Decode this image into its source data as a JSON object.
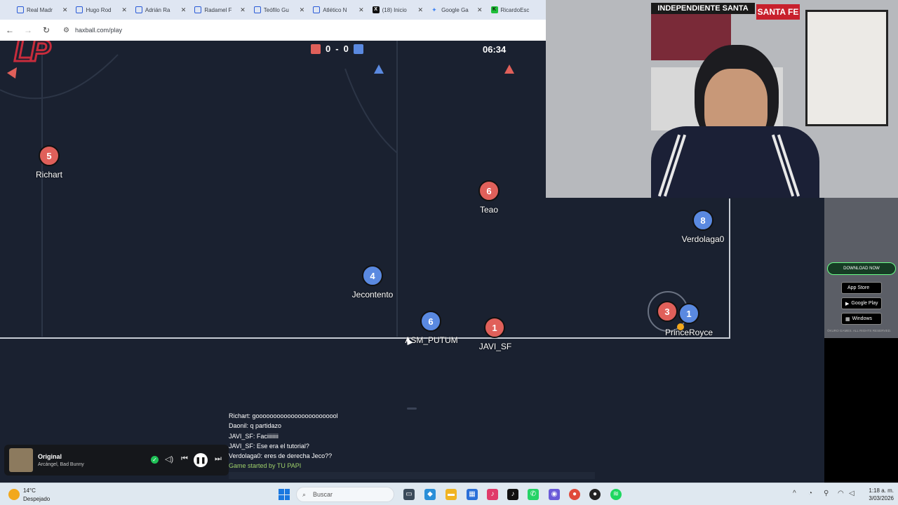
{
  "browser": {
    "tabs": [
      {
        "label": "Real Madr",
        "icon": "page-icon"
      },
      {
        "label": "Hugo Rod",
        "icon": "page-icon"
      },
      {
        "label": "Adrián Ra",
        "icon": "page-icon"
      },
      {
        "label": "Radamel F",
        "icon": "page-icon"
      },
      {
        "label": "Teófilo Gu",
        "icon": "page-icon"
      },
      {
        "label": "Atlético N",
        "icon": "page-icon"
      },
      {
        "label": "(18) Inicio",
        "icon": "x-icon"
      },
      {
        "label": "Google Ga",
        "icon": "gemini-icon"
      },
      {
        "label": "RicardoEsc",
        "icon": "kick-icon"
      }
    ],
    "url": "haxball.com/play"
  },
  "game": {
    "score_red": "0",
    "score_separator": "-",
    "score_blue": "0",
    "timer": "06:34",
    "colors": {
      "red": "#e0605a",
      "blue": "#5a89e0",
      "field": "#1a2130"
    },
    "players": [
      {
        "number": "5",
        "name": "Richart",
        "team": "red"
      },
      {
        "number": "6",
        "name": "Teao",
        "team": "red"
      },
      {
        "number": "8",
        "name": "Verdolaga0",
        "team": "blue"
      },
      {
        "number": "4",
        "name": "Jecontento",
        "team": "blue"
      },
      {
        "number": "6",
        "name": "ASM_PUTUM",
        "team": "blue"
      },
      {
        "number": "1",
        "name": "JAVI_SF",
        "team": "red"
      },
      {
        "number": "3",
        "name": "",
        "team": "red"
      },
      {
        "number": "1",
        "name": "PrinceRoyce",
        "team": "blue"
      }
    ]
  },
  "chat": {
    "messages": [
      "Richart: goooooooooooooooooooooool",
      "Daonil: q partidazo",
      "JAVI_SF: Faciiiiiiii",
      "JAVI_SF: Ese era el tutorial?",
      "Verdolaga0: eres de derecha Jeco??",
      "Game started by TU PAPI"
    ]
  },
  "media": {
    "title": "Original",
    "artist": "Arcángel, Bad Bunny"
  },
  "webcam": {
    "banner": "INDEPENDIENTE SANTA",
    "sign": "SANTA FE"
  },
  "ad": {
    "download": "DOWNLOAD NOW",
    "stores": [
      {
        "small": "Download on the",
        "label": "App Store"
      },
      {
        "small": "GET IT ON",
        "label": "Google Play"
      },
      {
        "small": "Download for",
        "label": "Windows"
      }
    ],
    "copyright": "©KURO GAMES. ALL RIGHTS RESERVED."
  },
  "taskbar": {
    "temperature": "14°C",
    "weather": "Despejado",
    "search_placeholder": "Buscar",
    "time": "1:18 a. m.",
    "date": "3/03/2026"
  }
}
